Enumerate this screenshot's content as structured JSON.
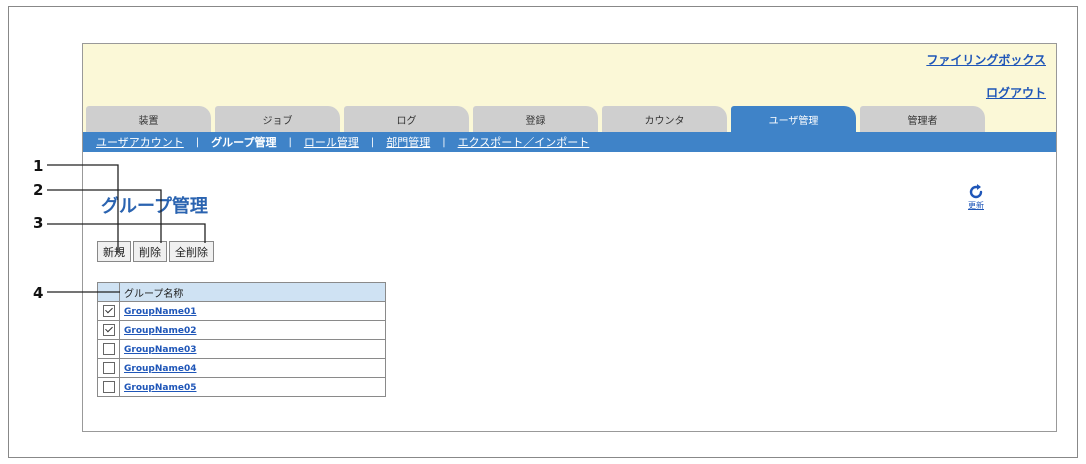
{
  "header": {
    "filing_box_link": "ファイリングボックス",
    "logout_link": "ログアウト"
  },
  "tabs": [
    {
      "label": "装置",
      "active": false
    },
    {
      "label": "ジョブ",
      "active": false
    },
    {
      "label": "ログ",
      "active": false
    },
    {
      "label": "登録",
      "active": false
    },
    {
      "label": "カウンタ",
      "active": false
    },
    {
      "label": "ユーザ管理",
      "active": true
    },
    {
      "label": "管理者",
      "active": false
    }
  ],
  "subnav": {
    "items": [
      {
        "label": "ユーザアカウント",
        "current": false
      },
      {
        "label": "グループ管理",
        "current": true
      },
      {
        "label": "ロール管理",
        "current": false
      },
      {
        "label": "部門管理",
        "current": false
      },
      {
        "label": "エクスポート／インポート",
        "current": false
      }
    ],
    "separator": "|"
  },
  "main": {
    "title": "グループ管理",
    "refresh_label": "更新",
    "buttons": {
      "new": "新規",
      "delete": "削除",
      "delete_all": "全削除"
    },
    "table": {
      "header": "グループ名称",
      "rows": [
        {
          "name": "GroupName01",
          "checked": true
        },
        {
          "name": "GroupName02",
          "checked": true
        },
        {
          "name": "GroupName03",
          "checked": false
        },
        {
          "name": "GroupName04",
          "checked": false
        },
        {
          "name": "GroupName05",
          "checked": false
        }
      ]
    }
  },
  "callouts": [
    "1",
    "2",
    "3",
    "4"
  ],
  "colors": {
    "header_bg": "#fbf8d7",
    "accent_blue": "#3f83c8",
    "link_blue": "#1f56b8",
    "title_blue": "#2a63b0",
    "tab_inactive": "#cfcfcf",
    "table_header_bg": "#cfe2f3"
  }
}
